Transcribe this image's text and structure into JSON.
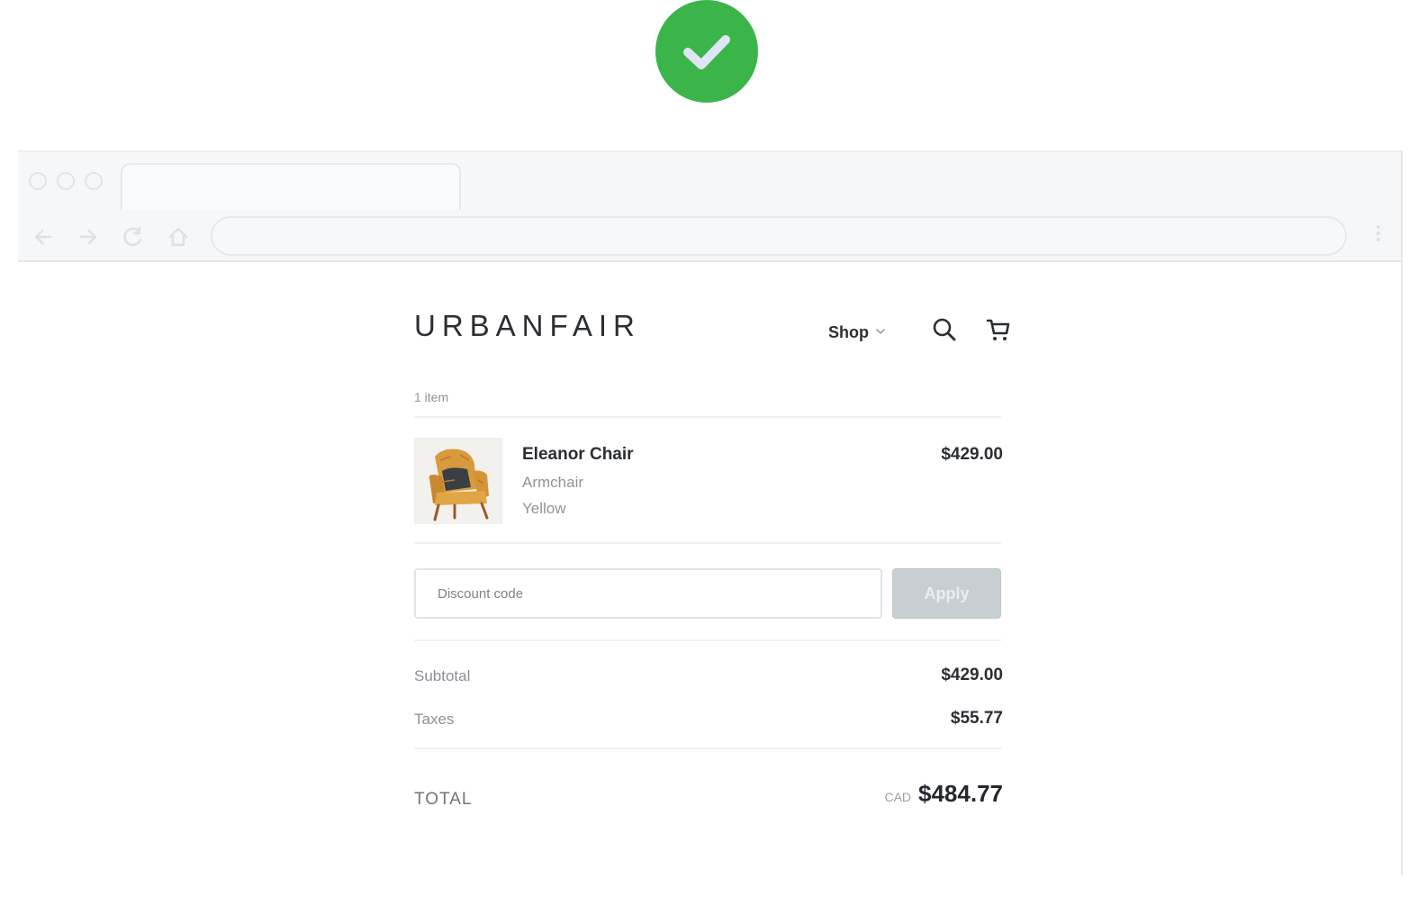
{
  "colors": {
    "success_green": "#3bb54a",
    "apply_disabled": "#c8cfd3"
  },
  "status": {
    "icon": "check-icon"
  },
  "browser": {
    "nav_icons": [
      "back-arrow-icon",
      "forward-arrow-icon",
      "reload-icon",
      "home-icon"
    ]
  },
  "store": {
    "logo": "URBANFAIR",
    "nav": {
      "shop_label": "Shop"
    }
  },
  "cart": {
    "items_count_label": "1 item",
    "items": [
      {
        "name": "Eleanor Chair",
        "type": "Armchair",
        "color": "Yellow",
        "price": "$429.00",
        "image": "armchair-image"
      }
    ],
    "discount": {
      "placeholder": "Discount code",
      "apply_label": "Apply"
    },
    "summary": {
      "subtotal_label": "Subtotal",
      "subtotal_value": "$429.00",
      "taxes_label": "Taxes",
      "taxes_value": "$55.77"
    },
    "total": {
      "label": "TOTAL",
      "currency": "CAD",
      "value": "$484.77"
    }
  }
}
